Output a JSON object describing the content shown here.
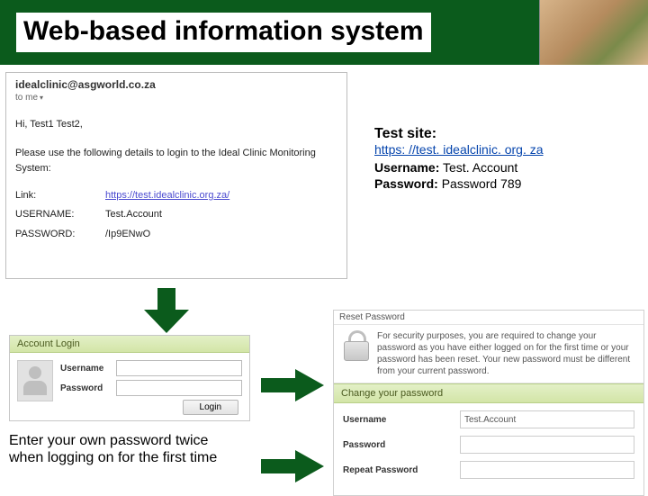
{
  "header": {
    "title": "Web-based information system"
  },
  "email": {
    "sender": "idealclinic@asgworld.co.za",
    "to_line": "to me",
    "greeting": "Hi, Test1 Test2,",
    "intro": "Please use the following details to login to the Ideal Clinic Monitoring System:",
    "link_label": "Link:",
    "link_value": "https://test.idealclinic.org.za/",
    "user_label": "USERNAME:",
    "user_value": "Test.Account",
    "pass_label": "PASSWORD:",
    "pass_value": "/Ip9ENwO"
  },
  "sidebar": {
    "heading": "Test site:",
    "site_url": "https: //test. idealclinic. org. za",
    "user_label": "Username:",
    "user_value": "Test. Account",
    "pass_label": "Password:",
    "pass_value": "Password 789"
  },
  "login": {
    "title": "Account Login",
    "user_label": "Username",
    "pass_label": "Password",
    "button": "Login"
  },
  "reset": {
    "top_title": "Reset Password",
    "message": "For security purposes, you are required to change your password as you have either logged on for the first time or your password has been reset. Your new password must be different from your current password.",
    "change_title": "Change your password",
    "user_label": "Username",
    "user_value": "Test.Account",
    "pass_label": "Password",
    "repeat_label": "Repeat Password"
  },
  "caption": "Enter your own password twice when logging on for the first time"
}
